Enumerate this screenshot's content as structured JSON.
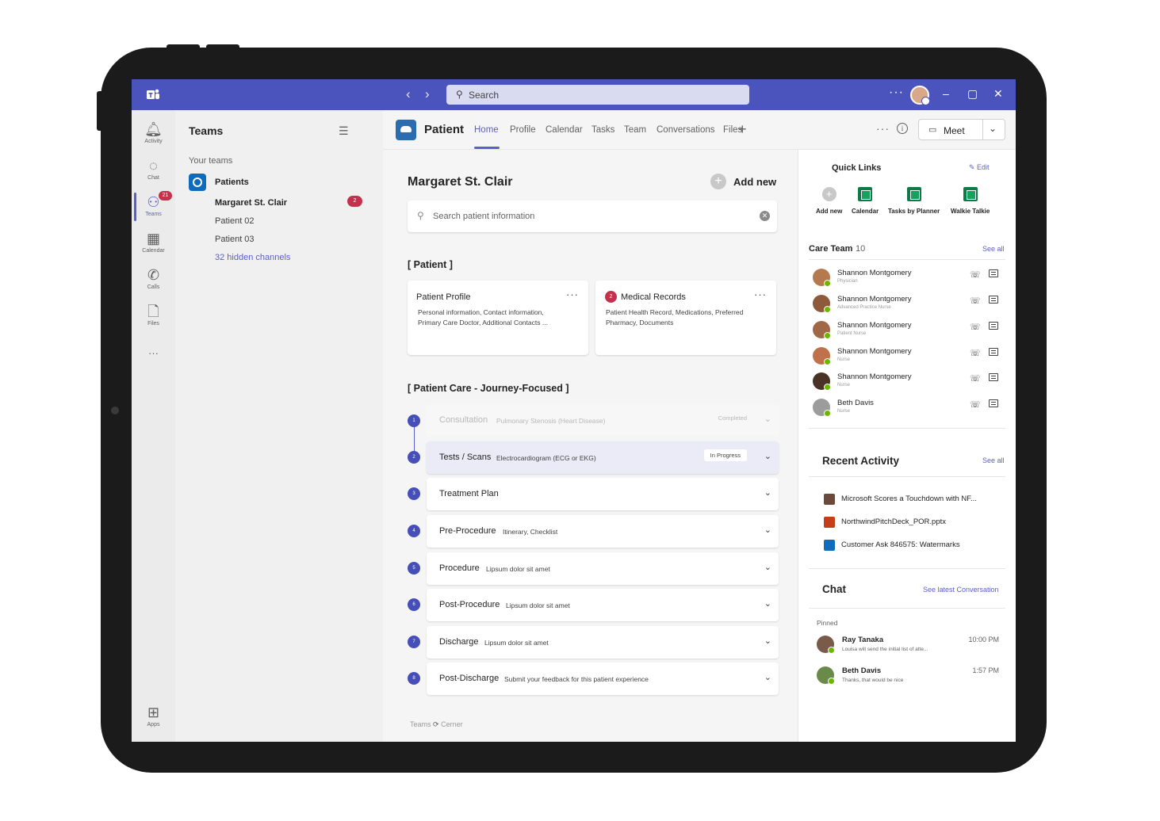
{
  "titlebar": {
    "search_placeholder": "Search",
    "more": "···"
  },
  "appbar": {
    "items": [
      {
        "label": "Activity",
        "icon": "bell-icon"
      },
      {
        "label": "Chat",
        "icon": "chat-icon"
      },
      {
        "label": "Teams",
        "icon": "teams-icon",
        "badge": "21"
      },
      {
        "label": "Calendar",
        "icon": "calendar-icon"
      },
      {
        "label": "Calls",
        "icon": "phone-icon"
      },
      {
        "label": "Files",
        "icon": "file-icon"
      },
      {
        "label": "···",
        "icon": "more-icon"
      },
      {
        "label": "Apps",
        "icon": "apps-icon"
      }
    ]
  },
  "teamslist": {
    "title": "Teams",
    "your_teams": "Your teams",
    "team_name": "Patients",
    "channels": [
      "Margaret St. Clair",
      "Patient 02",
      "Patient 03"
    ],
    "channel_badge": "2",
    "hidden_channels": "32 hidden channels"
  },
  "header": {
    "app_name": "Patient",
    "tabs": [
      "Home",
      "Profile",
      "Calendar",
      "Tasks",
      "Team",
      "Conversations",
      "Files"
    ],
    "meet_label": "Meet"
  },
  "center": {
    "patient_name": "Margaret St. Clair",
    "add_new": "Add new",
    "search_placeholder": "Search patient information",
    "section_patient": "[ Patient ]",
    "cards": [
      {
        "title": "Patient Profile",
        "desc": "Personal information, Contact information, Primary Care Doctor, Additional Contacts ..."
      },
      {
        "title": "Medical Records",
        "badge": "2",
        "desc": "Patient Health Record, Medications, Preferred Pharmacy, Documents"
      }
    ],
    "section_care": "[ Patient Care - Journey-Focused ]",
    "steps": [
      {
        "num": "1",
        "name": "Consultation",
        "desc": "Pulmonary Stenosis (Heart Disease)",
        "status": "Completed"
      },
      {
        "num": "2",
        "name": "Tests / Scans",
        "desc": "Electrocardiogram (ECG or EKG)",
        "status": "In Progress"
      },
      {
        "num": "3",
        "name": "Treatment Plan",
        "desc": "",
        "status": ""
      },
      {
        "num": "4",
        "name": "Pre-Procedure",
        "desc": "Itinerary, Checklist",
        "status": ""
      },
      {
        "num": "5",
        "name": "Procedure",
        "desc": "Lipsum dolor sit amet",
        "status": ""
      },
      {
        "num": "6",
        "name": "Post-Procedure",
        "desc": "Lipsum dolor sit amet",
        "status": ""
      },
      {
        "num": "7",
        "name": "Discharge",
        "desc": "Lipsum dolor sit amet",
        "status": ""
      },
      {
        "num": "8",
        "name": "Post-Discharge",
        "desc": "Submit your feedback for this patient experience",
        "status": ""
      }
    ],
    "footer_left": "Teams",
    "footer_right": "Cerner"
  },
  "right": {
    "quick_links_title": "Quick Links",
    "edit": "Edit",
    "quick_links": [
      "Add new",
      "Calendar",
      "Tasks by Planner",
      "Walkie Talkie"
    ],
    "care_team_title": "Care Team",
    "care_team_count": "10",
    "see_all": "See all",
    "members": [
      {
        "name": "Shannon Montgomery",
        "role": "Physician",
        "color": "#b5794f"
      },
      {
        "name": "Shannon Montgomery",
        "role": "Advanced Practice Nurse",
        "color": "#8d5a3c"
      },
      {
        "name": "Shannon Montgomery",
        "role": "Patient Nurse",
        "color": "#a06846"
      },
      {
        "name": "Shannon Montgomery",
        "role": "Nurse",
        "color": "#c0704a"
      },
      {
        "name": "Shannon Montgomery",
        "role": "Nurse",
        "color": "#4a3326"
      },
      {
        "name": "Beth Davis",
        "role": "Nurse",
        "color": "#9c9c9c"
      }
    ],
    "recent_activity_title": "Recent Activity",
    "recent": [
      {
        "text": "Microsoft Scores a Touchdown with NF...",
        "color": "#6b4a3a"
      },
      {
        "text": "NorthwindPitchDeck_POR.pptx",
        "color": "#c43e1c"
      },
      {
        "text": "Customer Ask 846575: Watermarks",
        "color": "#0f6cbd"
      }
    ],
    "chat_title": "Chat",
    "see_latest": "See latest Conversation",
    "pinned": "Pinned",
    "chats": [
      {
        "name": "Ray Tanaka",
        "preview": "Louisa will send the initial list of atte...",
        "time": "10:00 PM",
        "color": "#7a5a48"
      },
      {
        "name": "Beth Davis",
        "preview": "Thanks, that would be nice",
        "time": "1:57 PM",
        "color": "#6a8a4a"
      }
    ]
  }
}
